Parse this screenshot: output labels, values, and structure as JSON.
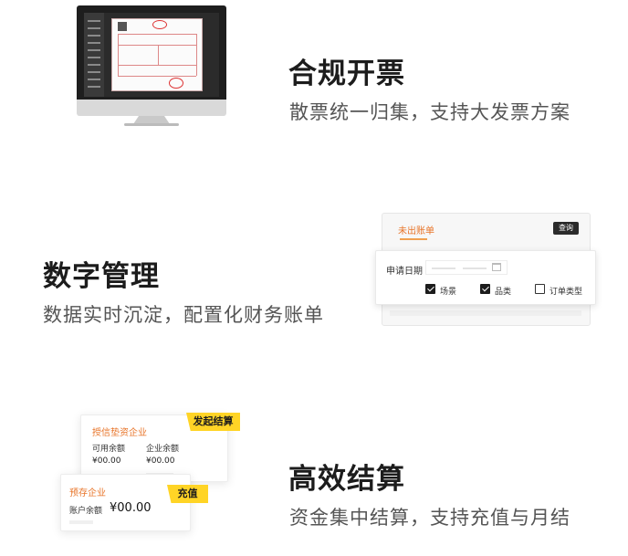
{
  "sections": [
    {
      "title": "合规开票",
      "subtitle": "散票统一归集，支持大发票方案"
    },
    {
      "title": "数字管理",
      "subtitle": "数据实时沉淀，配置化财务账单"
    },
    {
      "title": "高效结算",
      "subtitle": "资金集中结算，支持充值与月结"
    }
  ],
  "bill_panel": {
    "tab": "未出账单",
    "search_button": "查询",
    "date_label": "申请日期",
    "checkboxes": [
      {
        "label": "场景",
        "checked": true
      },
      {
        "label": "品类",
        "checked": true
      },
      {
        "label": "订单类型",
        "checked": false
      }
    ]
  },
  "settlement": {
    "card_a": {
      "org": "授信垫资企业",
      "action": "发起结算",
      "col1_label": "可用余额",
      "col1_value": "¥00.00",
      "col2_label": "企业余额",
      "col2_value": "¥00.00"
    },
    "card_b": {
      "org": "预存企业",
      "action": "充值",
      "balance_label": "账户余额",
      "balance_value": "¥00.00"
    }
  },
  "colors": {
    "accent": "#e8752a",
    "tag": "#ffd426",
    "title": "#1c1c1c",
    "subtitle": "#555555"
  }
}
